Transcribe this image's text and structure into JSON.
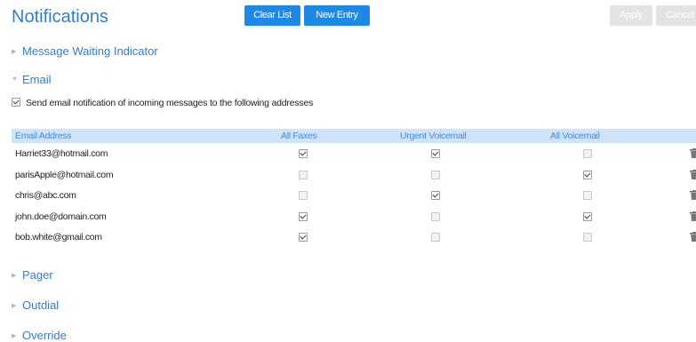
{
  "header": {
    "title": "Notifications",
    "clear_list": "Clear List",
    "new_entry": "New Entry",
    "apply": "Apply",
    "cancel": "Cancel"
  },
  "sections": {
    "mwi": "Message Waiting Indicator",
    "email": "Email",
    "pager": "Pager",
    "outdial": "Outdial",
    "override": "Override"
  },
  "email": {
    "send_notification_checked": true,
    "send_notification_label": "Send email notification of incoming messages to the following addresses",
    "columns": [
      "Email Address",
      "All Faxes",
      "Urgent Voicemail",
      "All Voicemail"
    ],
    "rows": [
      {
        "address": "Harriet33@hotmail.com",
        "all_faxes": true,
        "urgent_voicemail": true,
        "all_voicemail": false
      },
      {
        "address": "parisApple@hotmail.com",
        "all_faxes": false,
        "urgent_voicemail": false,
        "all_voicemail": true
      },
      {
        "address": "chris@abc.com",
        "all_faxes": false,
        "urgent_voicemail": true,
        "all_voicemail": false
      },
      {
        "address": "john.doe@domain.com",
        "all_faxes": true,
        "urgent_voicemail": false,
        "all_voicemail": true
      },
      {
        "address": "bob.white@gmail.com",
        "all_faxes": true,
        "urgent_voicemail": false,
        "all_voicemail": false
      }
    ]
  },
  "colors": {
    "accent": "#2f7fd1",
    "button": "#1e88e5",
    "header_bg": "#cfe3fb",
    "disabled": "#e3e3e3"
  },
  "icons": {
    "collapsed": "triangle-right-icon",
    "expanded": "triangle-down-icon",
    "delete": "trash-icon"
  }
}
